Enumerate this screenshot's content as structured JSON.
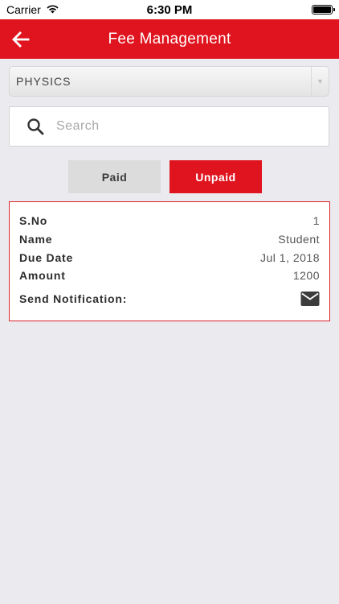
{
  "status_bar": {
    "carrier": "Carrier",
    "time": "6:30 PM"
  },
  "nav": {
    "title": "Fee Management",
    "back_icon": "arrow-left-icon",
    "color": "#e0141e"
  },
  "subject_select": {
    "value": "PHYSICS"
  },
  "search": {
    "placeholder": "Search",
    "value": ""
  },
  "tabs": [
    {
      "label": "Paid",
      "active": false
    },
    {
      "label": "Unpaid",
      "active": true
    }
  ],
  "fee_record": {
    "sno_label": "S.No",
    "sno_value": "1",
    "name_label": "Name",
    "name_value": "Student",
    "due_date_label": "Due Date",
    "due_date_value": "Jul 1, 2018",
    "amount_label": "Amount",
    "amount_value": "1200",
    "notification_label": "Send Notification:",
    "notification_icon": "mail-icon"
  }
}
